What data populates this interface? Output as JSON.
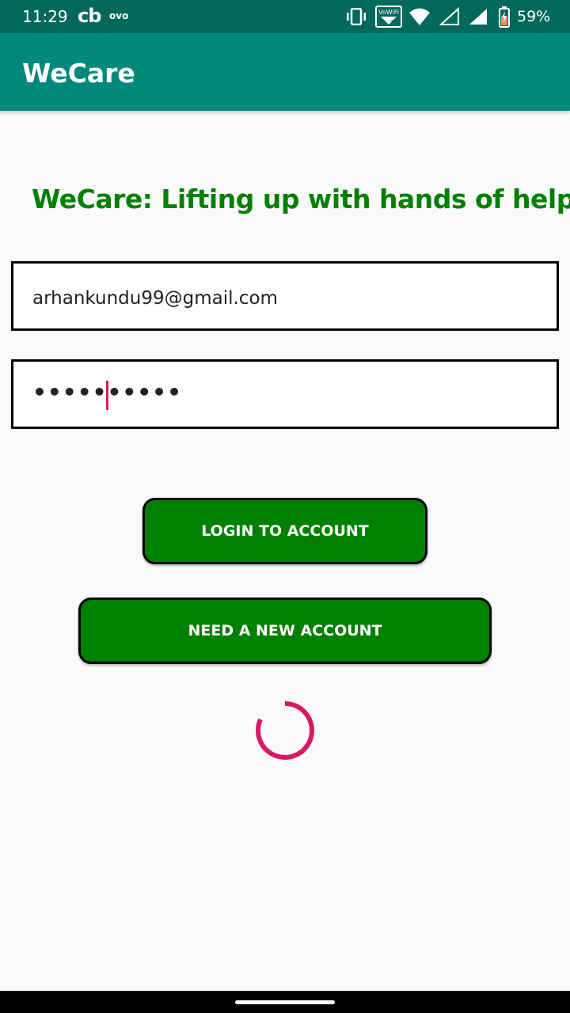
{
  "status_bar": {
    "time": "11:29",
    "app_icon_1": "cb",
    "app_icon_2": "ovo",
    "battery_percent": "59%",
    "icons": [
      "vibrate-icon",
      "vowifi-icon",
      "wifi-icon",
      "signal-empty-icon",
      "signal-full-icon",
      "battery-icon"
    ]
  },
  "app_bar": {
    "title": "WeCare"
  },
  "main": {
    "headline": "WeCare: Lifting up with hands of help",
    "email_value": "arhankundu99@gmail.com",
    "password_value": "••••••••••",
    "login_button": "LOGIN TO ACCOUNT",
    "register_button": "NEED A NEW ACCOUNT"
  },
  "colors": {
    "status_bar": "#00695c",
    "app_bar": "#00897b",
    "brand_green": "#008000",
    "accent": "#d81b60"
  }
}
